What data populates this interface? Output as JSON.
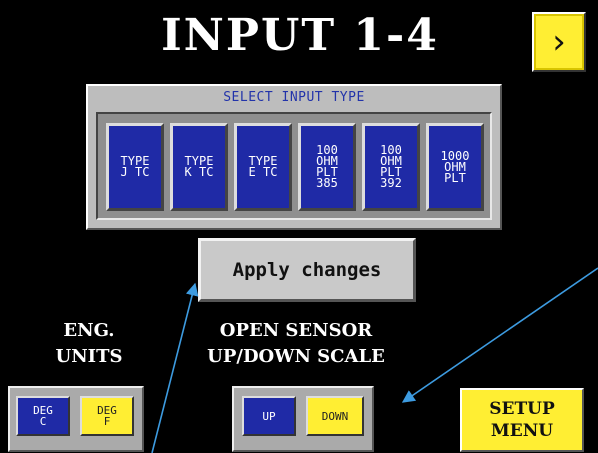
{
  "screen": {
    "title": "INPUT 1-4"
  },
  "nav": {
    "next_label": "›"
  },
  "input_type": {
    "title": "SELECT INPUT TYPE",
    "selected": "TYPE J TC",
    "options": [
      {
        "lines": [
          "TYPE",
          "J TC"
        ],
        "selected": true
      },
      {
        "lines": [
          "TYPE",
          "K TC"
        ],
        "selected": false
      },
      {
        "lines": [
          "TYPE",
          "E TC"
        ],
        "selected": false
      },
      {
        "lines": [
          "100",
          "OHM",
          "PLT",
          "385"
        ],
        "selected": false
      },
      {
        "lines": [
          "100",
          "OHM",
          "PLT",
          "392"
        ],
        "selected": false
      },
      {
        "lines": [
          "1000",
          "OHM",
          "PLT"
        ],
        "selected": false
      }
    ]
  },
  "apply": {
    "label": "Apply changes"
  },
  "eng_units": {
    "label_line1": "ENG.",
    "label_line2": "UNITS",
    "options": [
      {
        "lines": [
          "DEG",
          "C"
        ],
        "selected": false
      },
      {
        "lines": [
          "DEG",
          "F"
        ],
        "selected": true
      }
    ]
  },
  "open_sensor": {
    "label_line1": "OPEN SENSOR",
    "label_line2": "UP/DOWN SCALE",
    "options": [
      {
        "lines": [
          "UP"
        ],
        "selected": false
      },
      {
        "lines": [
          "DOWN"
        ],
        "selected": true
      }
    ]
  },
  "setup_menu": {
    "line1": "SETUP",
    "line2": "MENU"
  },
  "colors": {
    "background": "#000000",
    "selected": "#ffee33",
    "unselected": "#1f2aa6",
    "panel": "#bdbdbd",
    "annotation_arrow": "#3d9be0"
  }
}
